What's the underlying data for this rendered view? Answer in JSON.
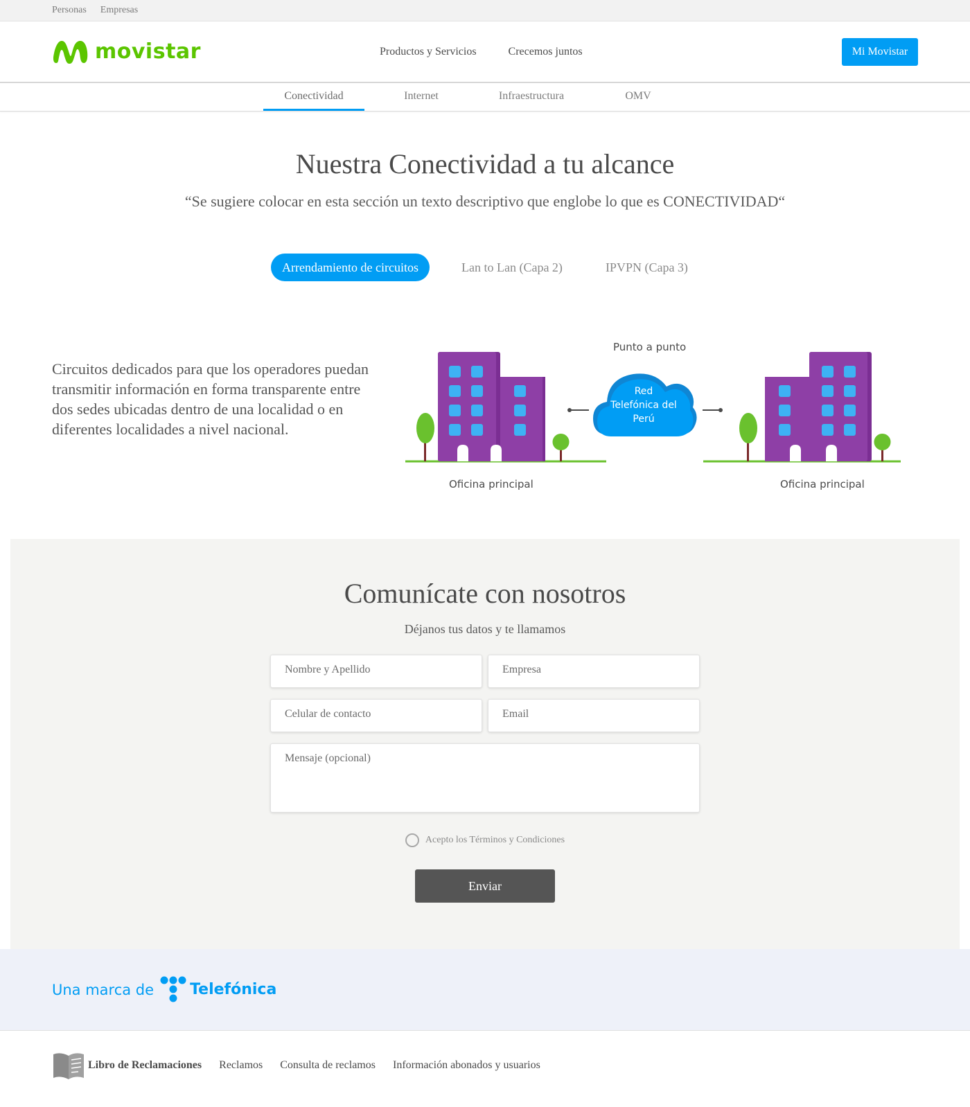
{
  "top_strip": {
    "links": [
      "Personas",
      "Empresas"
    ]
  },
  "header": {
    "logo_text": "movistar",
    "nav": [
      "Productos y Servicios",
      "Crecemos juntos"
    ],
    "cta": "Mi Movistar"
  },
  "sub_nav": {
    "items": [
      "Conectividad",
      "Internet",
      "Infraestructura",
      "OMV"
    ],
    "active": "Conectividad"
  },
  "hero": {
    "title": "Nuestra Conectividad a tu alcance",
    "subtitle": "“Se sugiere colocar en esta sección un texto descriptivo que englobe lo que es CONECTIVIDAD“"
  },
  "tabs": {
    "items": [
      "Arrendamiento de circuitos",
      "Lan to Lan (Capa 2)",
      "IPVPN (Capa 3)"
    ],
    "active": "Arrendamiento de circuitos"
  },
  "content": {
    "description": "Circuitos dedicados para que los operadores puedan transmitir información en forma transparente entre dos sedes ubicadas dentro de una localidad o en diferentes localidades a nivel nacional.",
    "diagram": {
      "title": "Punto a punto",
      "cloud_lines": [
        "Red",
        "Telefónica del",
        "Perú"
      ],
      "left_label": "Oficina principal",
      "right_label": "Oficina principal"
    }
  },
  "contact": {
    "title": "Comunícate con nosotros",
    "lead": "Déjanos tus datos y te llamamos",
    "fields": {
      "name": "Nombre y Apellido",
      "company": "Empresa",
      "phone": "Celular de contacto",
      "email": "Email",
      "message": "Mensaje (opcional)"
    },
    "terms": "Acepto los Términos y Condiciones",
    "submit": "Enviar"
  },
  "brand": {
    "prefix": "Una marca de",
    "name": "Telefónica"
  },
  "footer": {
    "libro": "Libro de Reclamaciones",
    "links": [
      "Reclamos",
      "Consulta de reclamos",
      "Información abonados y usuarios"
    ]
  },
  "colors": {
    "accent": "#019df4",
    "brand_green": "#5bc500",
    "building": "#8e3fa6",
    "button_dark": "#555555"
  }
}
